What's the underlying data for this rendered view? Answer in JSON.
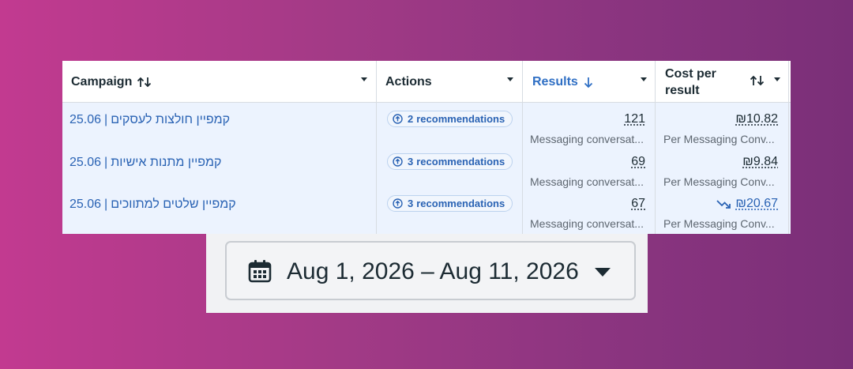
{
  "table": {
    "columns": {
      "campaign": {
        "label": "Campaign"
      },
      "actions": {
        "label": "Actions"
      },
      "results": {
        "label": "Results"
      },
      "cost": {
        "label_line1": "Cost per",
        "label_line2": "result"
      }
    },
    "rows": [
      {
        "campaign_name": "קמפיין חולצות לעסקים",
        "campaign_sep": "|",
        "campaign_date": "25.06",
        "rec_count": "2",
        "rec_label": "recommendations",
        "results": "121",
        "results_sub": "Messaging conversat...",
        "cost": "₪10.82",
        "cost_sub": "Per Messaging Conv..."
      },
      {
        "campaign_name": "קמפיין מתנות אישיות",
        "campaign_sep": "|",
        "campaign_date": "25.06",
        "rec_count": "3",
        "rec_label": "recommendations",
        "results": "69",
        "results_sub": "Messaging conversat...",
        "cost": "₪9.84",
        "cost_sub": "Per Messaging Conv..."
      },
      {
        "campaign_name": "קמפיין שלטים למתווכים",
        "campaign_sep": "|",
        "campaign_date": "25.06",
        "rec_count": "3",
        "rec_label": "recommendations",
        "results": "67",
        "results_sub": "Messaging conversat...",
        "cost": "₪20.67",
        "cost_sub": "Per Messaging Conv...",
        "cost_trend": "trending-down-icon"
      }
    ]
  },
  "date_range": {
    "label": "Aug 1, 2026 – Aug 11, 2026",
    "icon": "calendar-icon"
  },
  "colors": {
    "link": "#2a63b4",
    "sorted_header": "#2f6fc4",
    "row_bg": "#ecf3fe",
    "text": "#1c2b33",
    "muted": "#5d6670"
  }
}
